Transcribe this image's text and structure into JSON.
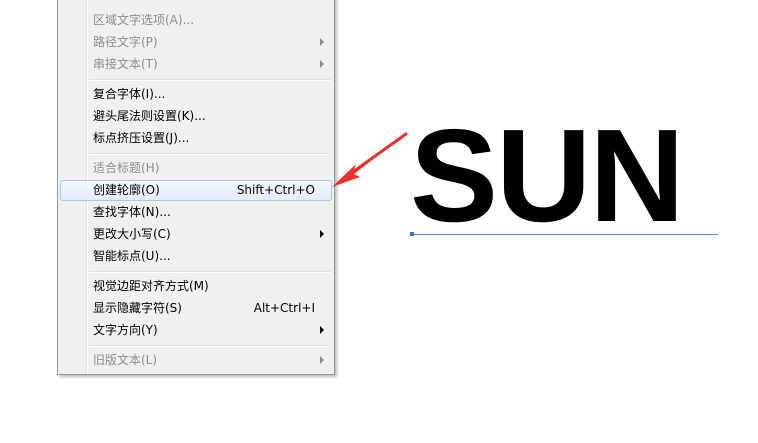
{
  "menu": {
    "items": [
      {
        "label": "区域文字选项(A)...",
        "shortcut": "",
        "submenu": false,
        "disabled": true,
        "highlight": false
      },
      {
        "label": "路径文字(P)",
        "shortcut": "",
        "submenu": true,
        "disabled": true,
        "highlight": false
      },
      {
        "label": "串接文本(T)",
        "shortcut": "",
        "submenu": true,
        "disabled": true,
        "highlight": false
      },
      {
        "label": "复合字体(I)...",
        "shortcut": "",
        "submenu": false,
        "disabled": false,
        "highlight": false
      },
      {
        "label": "避头尾法则设置(K)...",
        "shortcut": "",
        "submenu": false,
        "disabled": false,
        "highlight": false
      },
      {
        "label": "标点挤压设置(J)...",
        "shortcut": "",
        "submenu": false,
        "disabled": false,
        "highlight": false
      },
      {
        "label": "适合标题(H)",
        "shortcut": "",
        "submenu": false,
        "disabled": true,
        "highlight": false
      },
      {
        "label": "创建轮廓(O)",
        "shortcut": "Shift+Ctrl+O",
        "submenu": false,
        "disabled": false,
        "highlight": true
      },
      {
        "label": "查找字体(N)...",
        "shortcut": "",
        "submenu": false,
        "disabled": false,
        "highlight": false
      },
      {
        "label": "更改大小写(C)",
        "shortcut": "",
        "submenu": true,
        "disabled": false,
        "highlight": false
      },
      {
        "label": "智能标点(U)...",
        "shortcut": "",
        "submenu": false,
        "disabled": false,
        "highlight": false
      },
      {
        "label": "视觉边距对齐方式(M)",
        "shortcut": "",
        "submenu": false,
        "disabled": false,
        "highlight": false
      },
      {
        "label": "显示隐藏字符(S)",
        "shortcut": "Alt+Ctrl+I",
        "submenu": false,
        "disabled": false,
        "highlight": false
      },
      {
        "label": "文字方向(Y)",
        "shortcut": "",
        "submenu": true,
        "disabled": false,
        "highlight": false
      },
      {
        "label": "旧版文本(L)",
        "shortcut": "",
        "submenu": true,
        "disabled": true,
        "highlight": false
      }
    ]
  },
  "canvas": {
    "text": "SUN"
  },
  "colors": {
    "menu_background": "#f0f0f0",
    "highlight_border": "#a8c8eb",
    "annotation_arrow": "#e8322d",
    "baseline": "#4c8ad8"
  }
}
